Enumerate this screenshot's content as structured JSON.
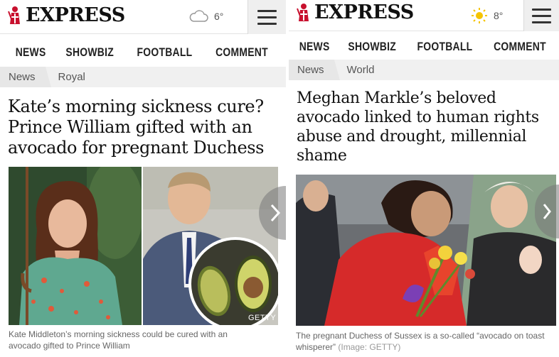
{
  "left": {
    "logo_text": "EXPRESS",
    "weather": {
      "icon": "cloud-icon",
      "temp": "6°"
    },
    "nav": [
      "NEWS",
      "SHOWBIZ",
      "FOOTBALL",
      "COMMENT"
    ],
    "breadcrumb": {
      "section": "News",
      "subsection": "Royal"
    },
    "headline": "Kate’s morning sickness cure? Prince William gifted with an avocado for pregnant Duchess",
    "image_credit": "GETTY",
    "caption": "Kate Middleton’s morning sickness could be cured with an avocado gifted to Prince William"
  },
  "right": {
    "logo_text": "EXPRESS",
    "weather": {
      "icon": "sun-icon",
      "temp": "8°"
    },
    "nav": [
      "NEWS",
      "SHOWBIZ",
      "FOOTBALL",
      "COMMENT"
    ],
    "breadcrumb": {
      "section": "News",
      "subsection": "World"
    },
    "headline": "Meghan Markle’s beloved avocado linked to human rights abuse and drought, millennial shame",
    "caption": "The pregnant Duchess of Sussex is a so-called “avocado on toast whisperer”",
    "caption_credit": "(Image: GETTY)"
  },
  "colors": {
    "brand_red": "#c8102e",
    "nav_text": "#222222",
    "crumb_bg": "#f0f0f0"
  }
}
